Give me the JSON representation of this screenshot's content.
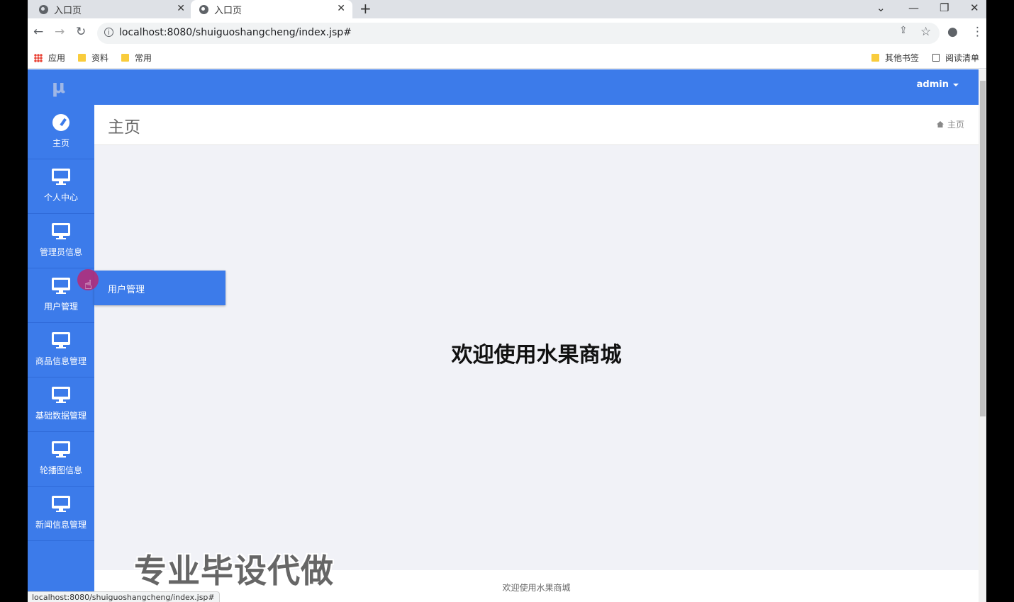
{
  "browser": {
    "tabs": [
      {
        "title": "入口页",
        "active": false
      },
      {
        "title": "入口页",
        "active": true
      }
    ],
    "url": "localhost:8080/shuiguoshangcheng/index.jsp#",
    "bookmarks": [
      "应用",
      "资料",
      "常用"
    ],
    "bookmarks_right": [
      "其他书签",
      "阅读清单"
    ],
    "status_url": "localhost:8080/shuiguoshangcheng/index.jsp#"
  },
  "header": {
    "logo": "μ",
    "user": "admin"
  },
  "sidebar": {
    "items": [
      {
        "label": "主页",
        "icon": "dashboard-icon"
      },
      {
        "label": "个人中心",
        "icon": "monitor-icon"
      },
      {
        "label": "管理员信息",
        "icon": "monitor-icon"
      },
      {
        "label": "用户管理",
        "icon": "monitor-icon"
      },
      {
        "label": "商品信息管理",
        "icon": "monitor-icon"
      },
      {
        "label": "基础数据管理",
        "icon": "monitor-icon"
      },
      {
        "label": "轮播图信息",
        "icon": "monitor-icon"
      },
      {
        "label": "新闻信息管理",
        "icon": "monitor-icon"
      }
    ],
    "submenu": {
      "label": "用户管理"
    }
  },
  "page": {
    "title": "主页",
    "breadcrumb": "主页",
    "welcome": "欢迎使用水果商城",
    "footer": "欢迎使用水果商城"
  },
  "overlay": {
    "watermark": "专业毕设代做"
  },
  "colors": {
    "primary": "#3c7bea",
    "content_bg": "#f1f2f7"
  }
}
